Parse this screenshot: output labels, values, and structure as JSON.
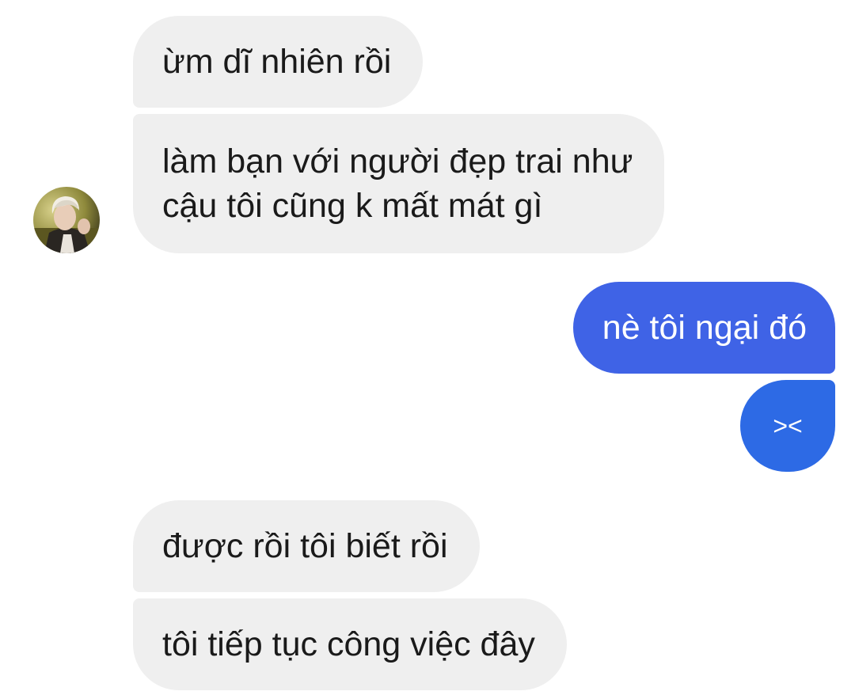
{
  "conversation": {
    "messages": [
      {
        "direction": "incoming",
        "lines": [
          "ừm dĩ nhiên rồi"
        ]
      },
      {
        "direction": "incoming",
        "lines": [
          "làm bạn với người đẹp trai như",
          "cậu tôi cũng k mất mát gì"
        ]
      },
      {
        "direction": "outgoing",
        "lines": [
          "nè tôi ngại đó"
        ]
      },
      {
        "direction": "outgoing",
        "lines": [
          "><"
        ]
      },
      {
        "direction": "incoming",
        "lines": [
          "được rồi tôi biết rồi"
        ]
      },
      {
        "direction": "incoming",
        "lines": [
          "tôi tiếp tục công việc đây"
        ]
      }
    ],
    "contact_avatar_icon": "contact-avatar-photo"
  },
  "colors": {
    "incoming_bubble": "#efefef",
    "outgoing_bubble_top": "#3f63e6",
    "outgoing_bubble_bottom": "#2d6ae5",
    "incoming_text": "#1a1a1a",
    "outgoing_text": "#ffffff"
  }
}
